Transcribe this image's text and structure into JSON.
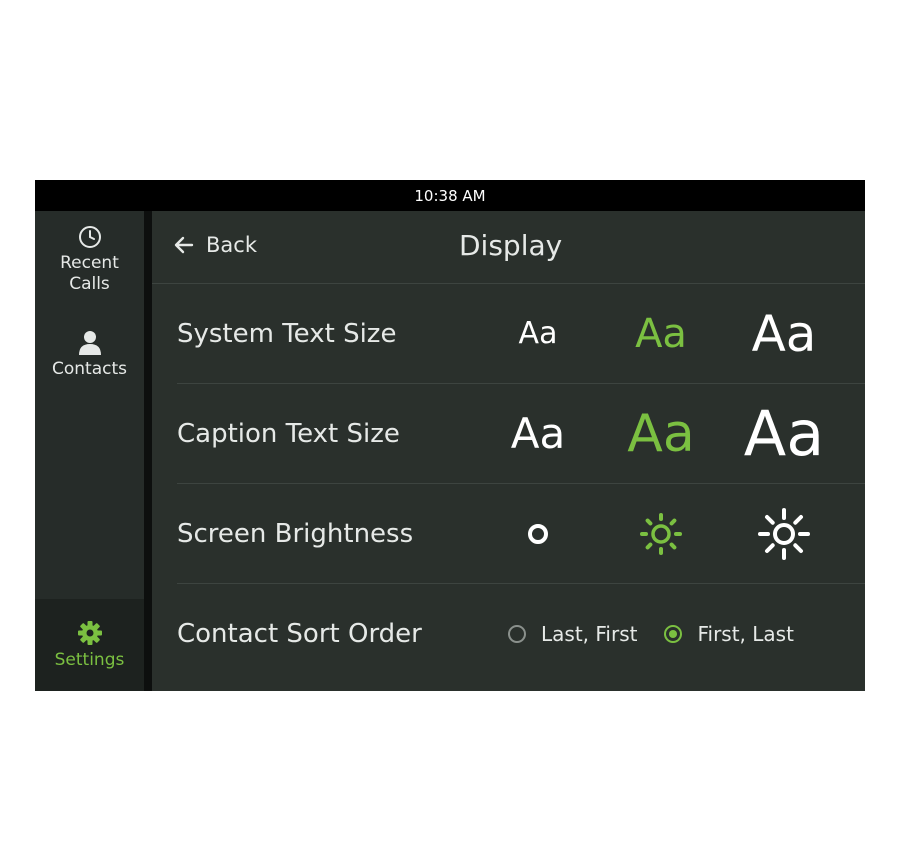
{
  "status_bar": {
    "time": "10:38 AM"
  },
  "sidebar": {
    "items": [
      {
        "id": "recent",
        "label_line1": "Recent",
        "label_line2": "Calls",
        "icon": "clock-icon"
      },
      {
        "id": "contacts",
        "label": "Contacts",
        "icon": "person-icon"
      },
      {
        "id": "settings",
        "label": "Settings",
        "icon": "gear-icon",
        "active": true
      }
    ]
  },
  "header": {
    "back_label": "Back",
    "title": "Display"
  },
  "rows": {
    "system_text": {
      "label": "System Text Size",
      "options": [
        "Aa",
        "Aa",
        "Aa"
      ],
      "selected": 1
    },
    "caption_text": {
      "label": "Caption Text Size",
      "options": [
        "Aa",
        "Aa",
        "Aa"
      ],
      "selected": 1
    },
    "brightness": {
      "label": "Screen Brightness",
      "levels": [
        "low",
        "medium",
        "high"
      ],
      "selected": 1
    },
    "sort_order": {
      "label": "Contact Sort Order",
      "options": [
        "Last, First",
        "First, Last"
      ],
      "selected": 1
    }
  },
  "colors": {
    "accent": "#7bc041",
    "text": "#e6e9e7",
    "background": "#2a302c",
    "sidebar": "#262c29"
  }
}
